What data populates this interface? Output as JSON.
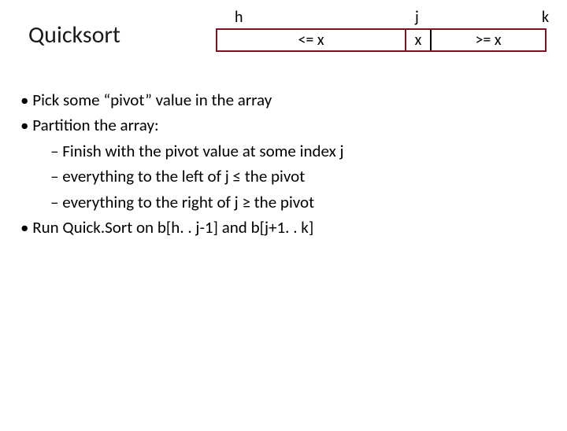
{
  "title": "Quicksort",
  "diagram": {
    "label_h": "h",
    "label_j": "j",
    "label_k": "k",
    "seg_left": "<= x",
    "seg_pivot": "x",
    "seg_right": ">= x"
  },
  "bullets": {
    "b1": "Pick some “pivot” value in the array",
    "b2": "Partition the array:",
    "b2a": "Finish with the pivot value at some index j",
    "b2b": "everything to the left of j ≤ the pivot",
    "b2c": "everything to the right of j  ≥ the pivot",
    "b3": "Run Quick.Sort on b[h. . j-1] and b[j+1. . k]"
  }
}
